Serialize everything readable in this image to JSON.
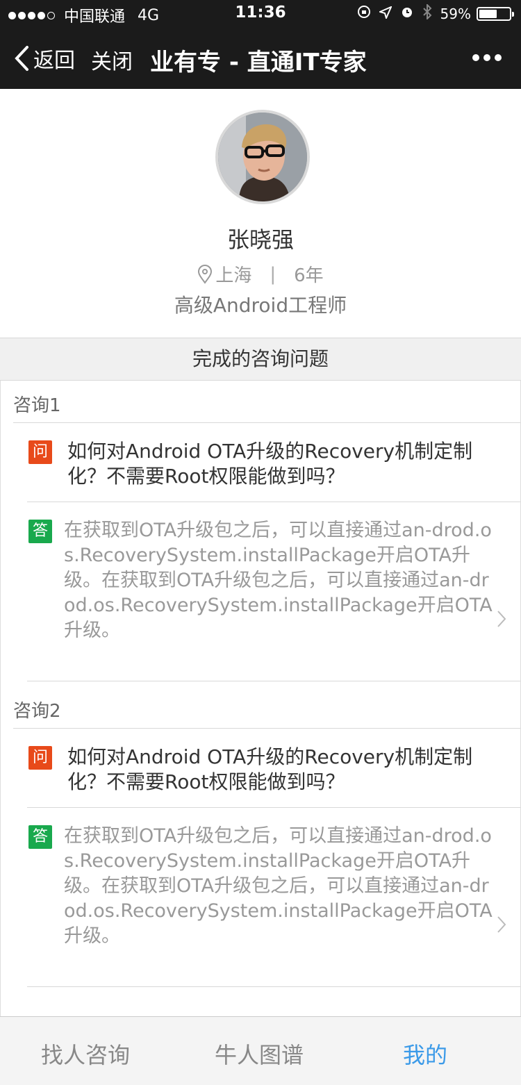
{
  "status_bar": {
    "carrier": "中国联通",
    "network": "4G",
    "time": "11:36",
    "battery_percent": "59%",
    "battery_level": 0.59
  },
  "nav": {
    "back_label": "返回",
    "close_label": "关闭",
    "title": "业有专 - 直通IT专家"
  },
  "profile": {
    "name": "张晓强",
    "location": "上海",
    "separator": "|",
    "experience": "6年",
    "job_title": "高级Android工程师"
  },
  "section": {
    "title": "完成的咨询问题"
  },
  "consults": [
    {
      "label": "咨询1",
      "q_badge": "问",
      "question": "如何对Android OTA升级的Recovery机制定制化？不需要Root权限能做到吗？",
      "a_badge": "答",
      "answer": "在获取到OTA升级包之后，可以直接通过an-drod.os.RecoverySystem.installPackage开启OTA升级。在获取到OTA升级包之后，可以直接通过an-drod.os.RecoverySystem.installPackage开启OTA升级。"
    },
    {
      "label": "咨询2",
      "q_badge": "问",
      "question": "如何对Android OTA升级的Recovery机制定制化？不需要Root权限能做到吗？",
      "a_badge": "答",
      "answer": "在获取到OTA升级包之后，可以直接通过an-drod.os.RecoverySystem.installPackage开启OTA升级。在获取到OTA升级包之后，可以直接通过an-drod.os.RecoverySystem.installPackage开启OTA升级。"
    }
  ],
  "tabs": [
    {
      "label": "找人咨询"
    },
    {
      "label": "牛人图谱"
    },
    {
      "label": "我的"
    }
  ],
  "colors": {
    "nav_bg": "#1b1b1b",
    "question_badge": "#e84a1a",
    "answer_badge": "#19a94d",
    "active_tab": "#3b9ae8"
  }
}
